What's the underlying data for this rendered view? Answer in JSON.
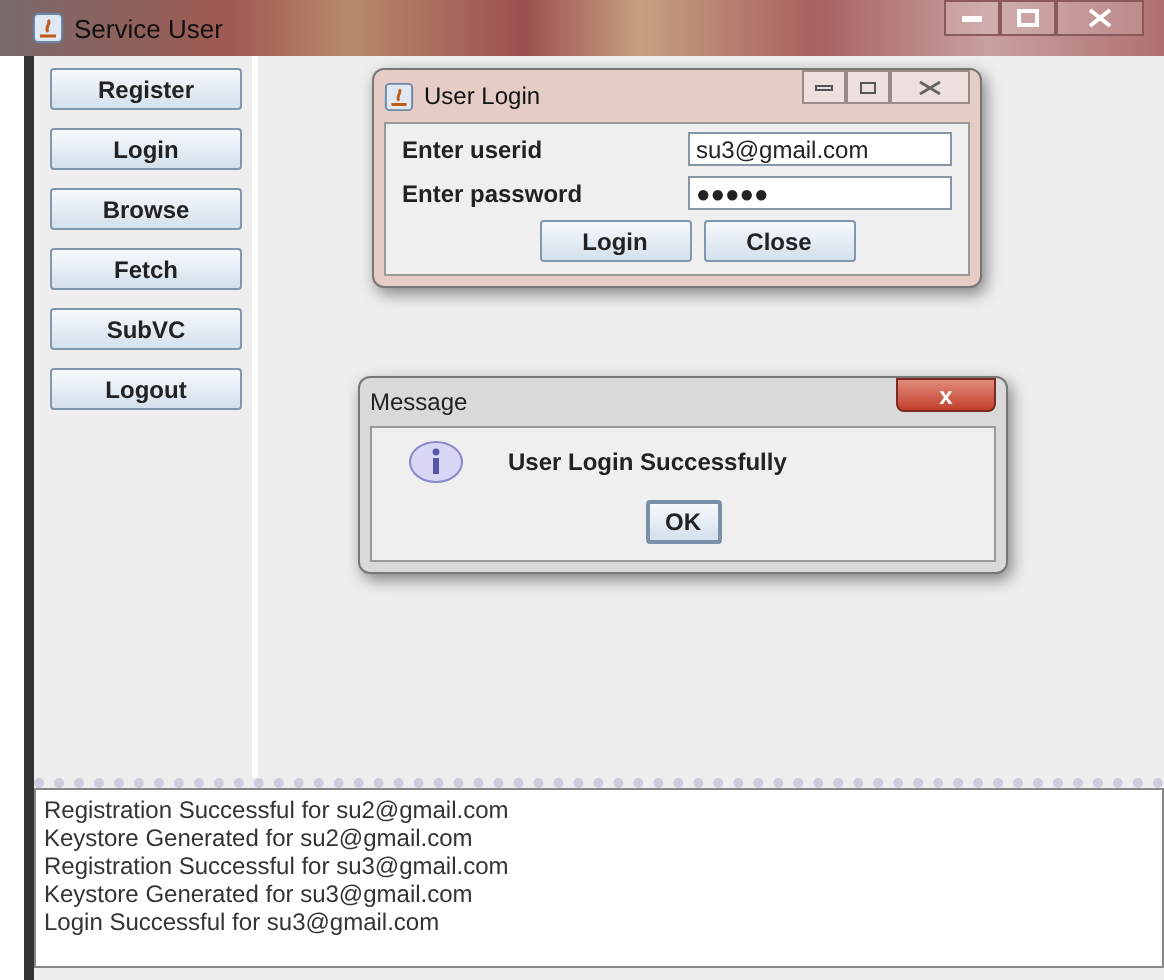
{
  "window": {
    "title": "Service User"
  },
  "sidebar": {
    "buttons": [
      "Register",
      "Login",
      "Browse",
      "Fetch",
      "SubVC",
      "Logout"
    ]
  },
  "login_dialog": {
    "title": "User Login",
    "fields": [
      {
        "label": "Enter userid",
        "value": "su3@gmail.com"
      },
      {
        "label": "Enter password",
        "value": "●●●●●"
      }
    ],
    "buttons": [
      "Login",
      "Close"
    ]
  },
  "message_dialog": {
    "title": "Message",
    "close": "x",
    "text": "User Login Successfully",
    "button": "OK"
  },
  "log": [
    "Registration Successful for su2@gmail.com",
    "Keystore Generated for su2@gmail.com",
    "Registration Successful for su3@gmail.com",
    "Keystore Generated for su3@gmail.com",
    "Login Successful for su3@gmail.com"
  ]
}
